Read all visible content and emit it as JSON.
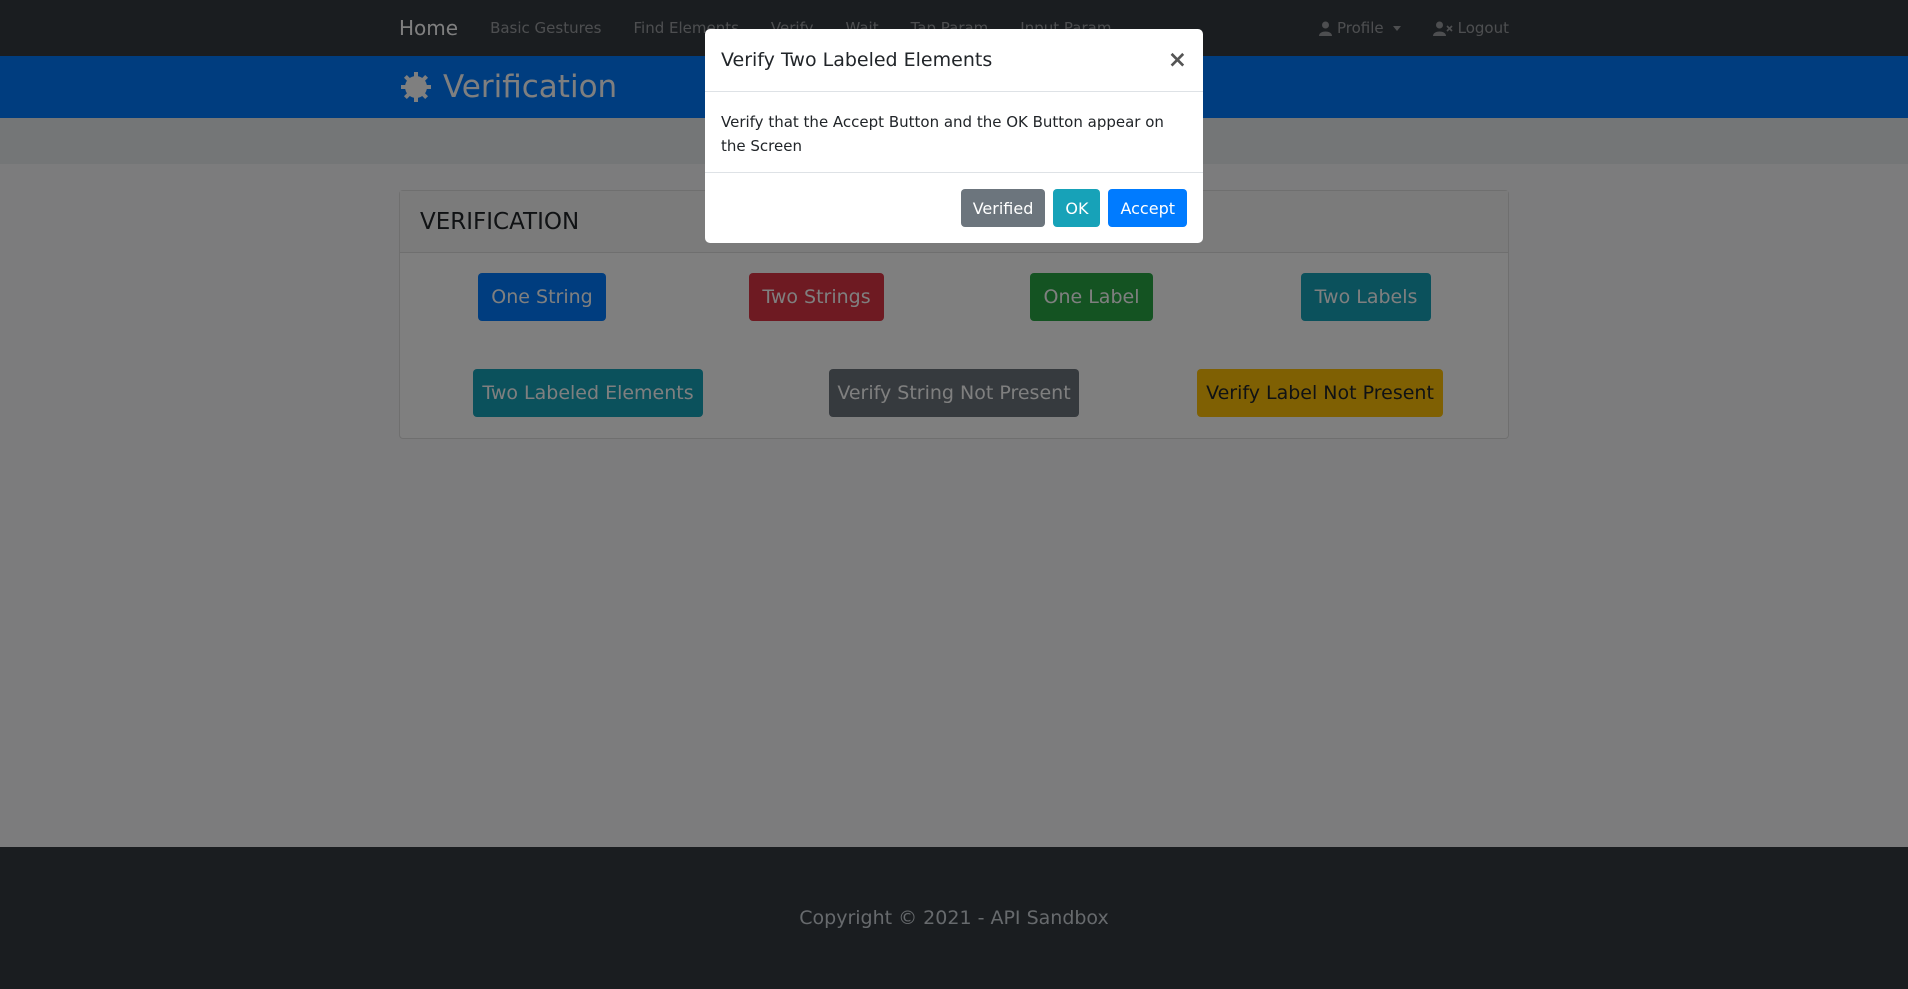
{
  "navbar": {
    "brand": "Home",
    "links": [
      "Basic Gestures",
      "Find Elements",
      "Verify",
      "Wait",
      "Tap Param",
      "Input Param"
    ],
    "profile": "Profile",
    "logout": "Logout"
  },
  "header": {
    "title": "Verification"
  },
  "card": {
    "title": "VERIFICATION",
    "buttons": [
      "One String",
      "Two Strings",
      "One Label",
      "Two Labels",
      "Two Labeled Elements",
      "Verify String Not Present",
      "Verify Label Not Present"
    ]
  },
  "footer": {
    "text": "Copyright © 2021 - API Sandbox"
  },
  "modal": {
    "title": "Verify Two Labeled Elements",
    "close": "×",
    "body": "Verify that the Accept Button and the OK Button appear on the Screen",
    "buttons": [
      "Verified",
      "OK",
      "Accept"
    ]
  },
  "colors": {
    "navbar": "#343a40",
    "primary": "#007bff",
    "danger": "#dc3545",
    "success": "#28a745",
    "info": "#17a2b8",
    "secondary": "#6c757d",
    "warning": "#ffc107"
  },
  "icons": {
    "header": "gear-icon",
    "profile": "user-icon",
    "logout": "user-x-icon"
  }
}
